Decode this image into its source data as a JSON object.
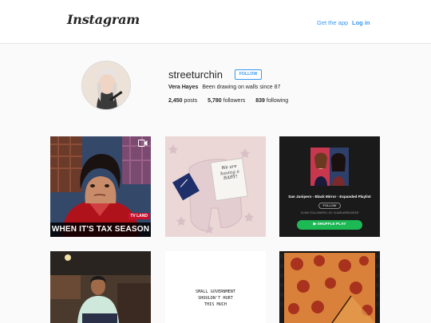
{
  "header": {
    "logo": "Instagram",
    "get_app": "Get the app",
    "login": "Log in"
  },
  "profile": {
    "username": "streeturchin",
    "follow_label": "FOLLOW",
    "full_name": "Vera Hayes",
    "bio": "Been drawing on walls since 87",
    "posts_count": "2,450",
    "posts_label": "posts",
    "followers_count": "5,780",
    "followers_label": "followers",
    "following_count": "839",
    "following_label": "following"
  },
  "posts": [
    {
      "caption": "WHEN IT'S TAX SEASON",
      "badge": "TV LAND",
      "icon": "video-icon"
    },
    {
      "card_lines": [
        "We are",
        "having a",
        "BABY!"
      ]
    },
    {
      "playlist_title": "San Junipero - Black Mirror - Expanded Playlist",
      "follow": "FOLLOW",
      "meta": "22,960 FOLLOWERS • BY CHARLIEBROOKER",
      "shuffle": "SHUFFLE PLAY"
    },
    {},
    {
      "lines": [
        "SMALL GOVERNMENT",
        "SHOULDN'T HURT",
        "THIS MUCH"
      ]
    },
    {}
  ],
  "colors": {
    "accent": "#3897f0",
    "spotify_green": "#1db954"
  }
}
